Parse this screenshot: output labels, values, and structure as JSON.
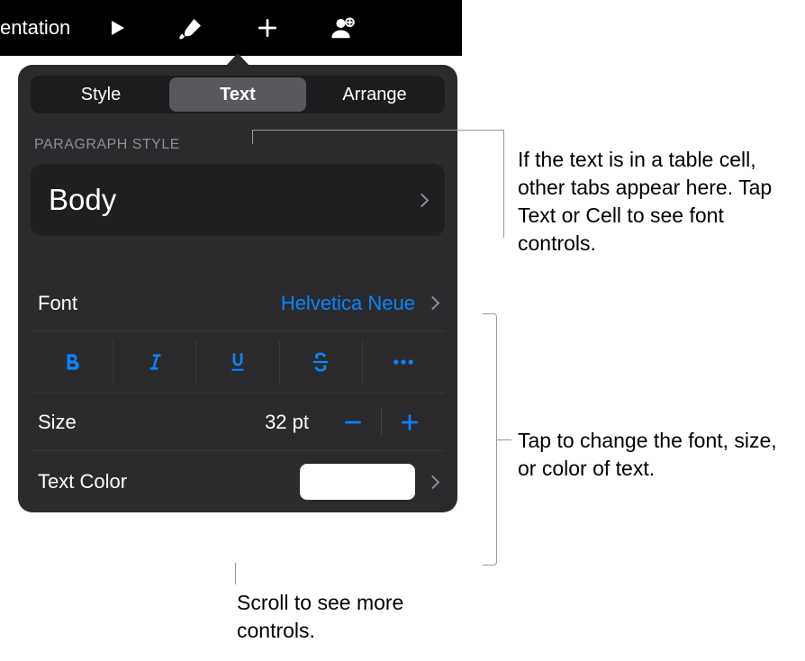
{
  "toolbar": {
    "title_fragment": "entation"
  },
  "tabs": {
    "style": "Style",
    "text": "Text",
    "arrange": "Arrange"
  },
  "paragraph_style": {
    "section_label": "Paragraph Style",
    "value": "Body"
  },
  "font": {
    "label": "Font",
    "value": "Helvetica Neue"
  },
  "size": {
    "label": "Size",
    "value": "32 pt"
  },
  "text_color": {
    "label": "Text Color",
    "value_hex": "#ffffff"
  },
  "callouts": {
    "tabs_note": "If the text is in a table cell, other tabs appear here. Tap Text or Cell to see font controls.",
    "font_note": "Tap to change the font, size, or color of text.",
    "scroll_note": "Scroll to see more controls."
  }
}
